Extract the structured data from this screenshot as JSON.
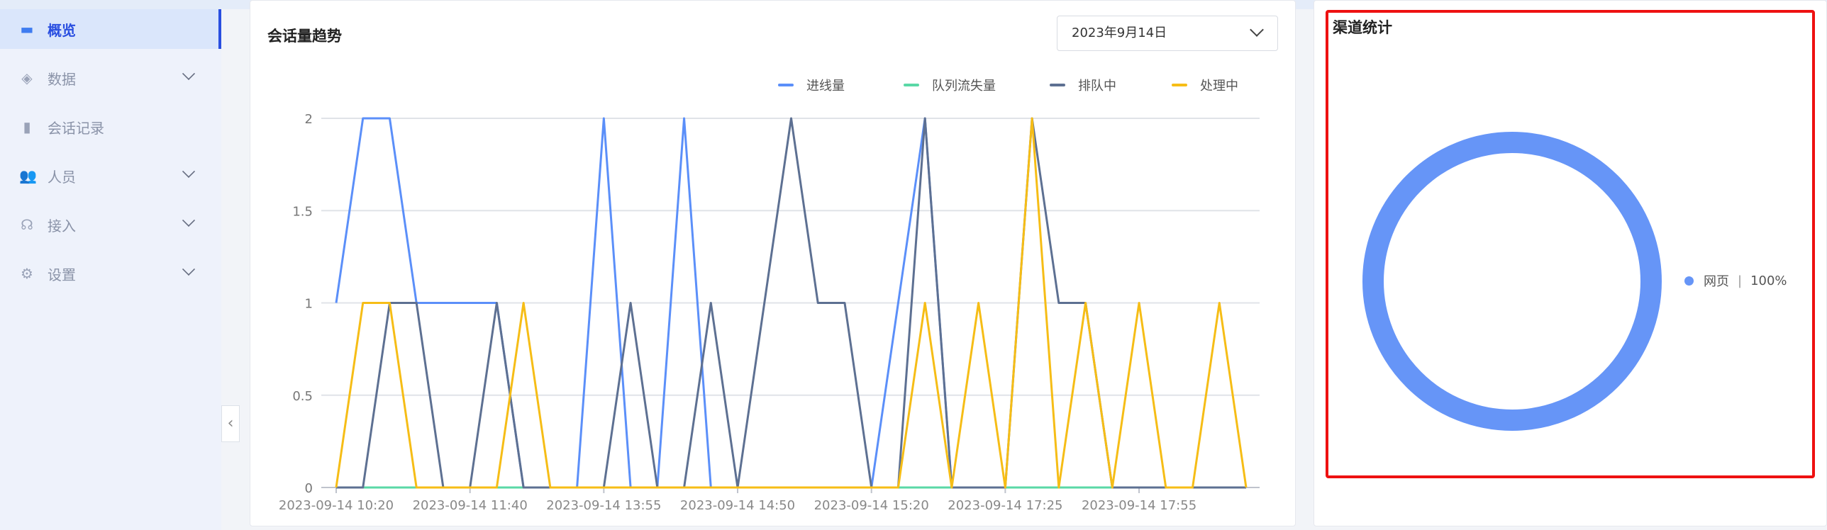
{
  "sidebar": {
    "items": [
      {
        "label": "概览",
        "icon": "dashboard-icon",
        "active": true,
        "expandable": false
      },
      {
        "label": "数据",
        "icon": "layers-icon",
        "expandable": true
      },
      {
        "label": "会话记录",
        "icon": "chat-record-icon",
        "expandable": false
      },
      {
        "label": "人员",
        "icon": "users-icon",
        "expandable": true
      },
      {
        "label": "接入",
        "icon": "headset-icon",
        "expandable": true
      },
      {
        "label": "设置",
        "icon": "gear-icon",
        "expandable": true
      }
    ],
    "collapse_glyph": "‹"
  },
  "trend": {
    "title": "会话量趋势",
    "date": "2023年9月14日"
  },
  "channel": {
    "title": "渠道统计",
    "legend": [
      {
        "name": "网页",
        "sep": "|",
        "pct": "100%",
        "color": "#6695f7"
      }
    ]
  },
  "chart_data": {
    "type": "line",
    "title": "会话量趋势",
    "ylim": [
      0,
      2
    ],
    "yticks": [
      "0",
      "0.5",
      "1",
      "1.5",
      "2"
    ],
    "xtick_labels": [
      "2023-09-14 10:20",
      "2023-09-14 11:40",
      "2023-09-14 13:55",
      "2023-09-14 14:50",
      "2023-09-14 15:20",
      "2023-09-14 17:25",
      "2023-09-14 17:55"
    ],
    "xtick_every": 5,
    "points": 35,
    "legend_placement": "top-right",
    "series": [
      {
        "name": "进线量",
        "color": "#5b8ff9",
        "values": [
          1,
          2,
          2,
          1,
          1,
          1,
          1,
          0,
          0,
          0,
          2,
          0,
          0,
          2,
          0,
          0,
          0,
          0,
          0,
          0,
          0,
          1,
          2,
          0,
          0,
          0,
          0,
          0,
          0,
          0,
          0,
          0,
          0,
          0,
          0
        ]
      },
      {
        "name": "队列流失量",
        "color": "#5ad8a6",
        "values": [
          0,
          0,
          0,
          0,
          0,
          0,
          0,
          0,
          0,
          0,
          0,
          0,
          0,
          0,
          0,
          0,
          0,
          0,
          0,
          0,
          0,
          0,
          0,
          0,
          0,
          0,
          0,
          0,
          0,
          0,
          0,
          0,
          0,
          0,
          0
        ]
      },
      {
        "name": "排队中",
        "color": "#5d7092",
        "values": [
          0,
          0,
          1,
          1,
          0,
          0,
          1,
          0,
          0,
          0,
          0,
          1,
          0,
          0,
          1,
          0,
          1,
          2,
          1,
          1,
          0,
          0,
          2,
          0,
          0,
          0,
          2,
          1,
          1,
          0,
          0,
          0,
          0,
          0,
          0
        ]
      },
      {
        "name": "处理中",
        "color": "#f6bd16",
        "values": [
          0,
          1,
          1,
          0,
          0,
          0,
          0,
          1,
          0,
          0,
          0,
          0,
          0,
          0,
          0,
          0,
          0,
          0,
          0,
          0,
          0,
          0,
          1,
          0,
          1,
          0,
          2,
          0,
          1,
          0,
          1,
          0,
          0,
          1,
          0
        ]
      }
    ]
  }
}
